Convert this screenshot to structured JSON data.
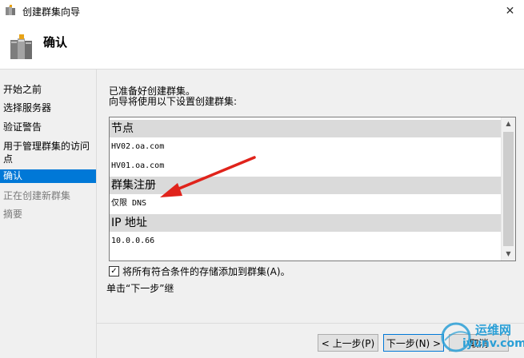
{
  "window": {
    "title": "创建群集向导",
    "close_glyph": "✕"
  },
  "header": {
    "title": "确认"
  },
  "sidebar": {
    "items": [
      {
        "label": "开始之前",
        "state": "normal"
      },
      {
        "label": "选择服务器",
        "state": "normal"
      },
      {
        "label": "验证警告",
        "state": "normal"
      },
      {
        "label": "用于管理群集的访问",
        "label2": "点",
        "state": "normal"
      },
      {
        "label": "确认",
        "state": "active"
      },
      {
        "label": "正在创建新群集",
        "state": "disabled"
      },
      {
        "label": "摘要",
        "state": "disabled"
      }
    ]
  },
  "main": {
    "ready_text": "已准备好创建群集。",
    "settings_text": "向导将使用以下设置创建群集:",
    "list": {
      "sections": [
        {
          "title": "节点",
          "entries": [
            "HV02.oa.com",
            "HV01.oa.com"
          ]
        },
        {
          "title": "群集注册",
          "entries": [
            "仅限 DNS"
          ]
        },
        {
          "title": "IP 地址",
          "entries": [
            "10.0.0.66"
          ]
        }
      ]
    },
    "checkbox": {
      "checked": true,
      "mark": "✓",
      "label": "将所有符合条件的存储添加到群集(A)。"
    },
    "hint": "单击“下一步”继"
  },
  "buttons": {
    "prev": "< 上一步(P)",
    "next": "下一步(N) >",
    "cancel": "取消"
  },
  "watermark": {
    "line1": "运维网",
    "line2": "iyunv.com"
  },
  "colors": {
    "accent": "#0078d7",
    "arrow": "#e0231b",
    "section_bg": "#dadada",
    "panel_bg": "#f0f0f0"
  },
  "icons": {
    "app": "cluster-servers-icon",
    "wizard": "cluster-servers-icon",
    "logo": "globe-logo-icon"
  }
}
